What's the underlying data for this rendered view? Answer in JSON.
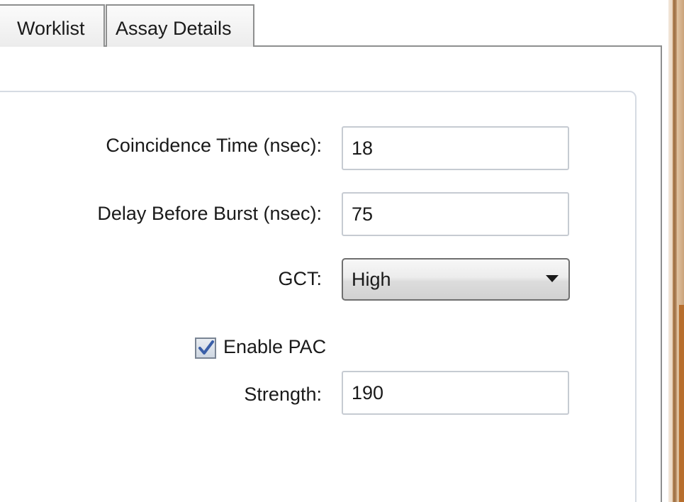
{
  "tabs": [
    {
      "label": "Worklist"
    },
    {
      "label": "Assay Details"
    }
  ],
  "form": {
    "coincidence_time": {
      "label": "Coincidence Time (nsec):",
      "value": "18"
    },
    "delay_before_burst": {
      "label": "Delay Before Burst (nsec):",
      "value": "75"
    },
    "gct": {
      "label": "GCT:",
      "selected": "High"
    },
    "enable_pac": {
      "label": "Enable PAC",
      "checked": true
    },
    "strength": {
      "label": "Strength:",
      "value": "190"
    }
  }
}
